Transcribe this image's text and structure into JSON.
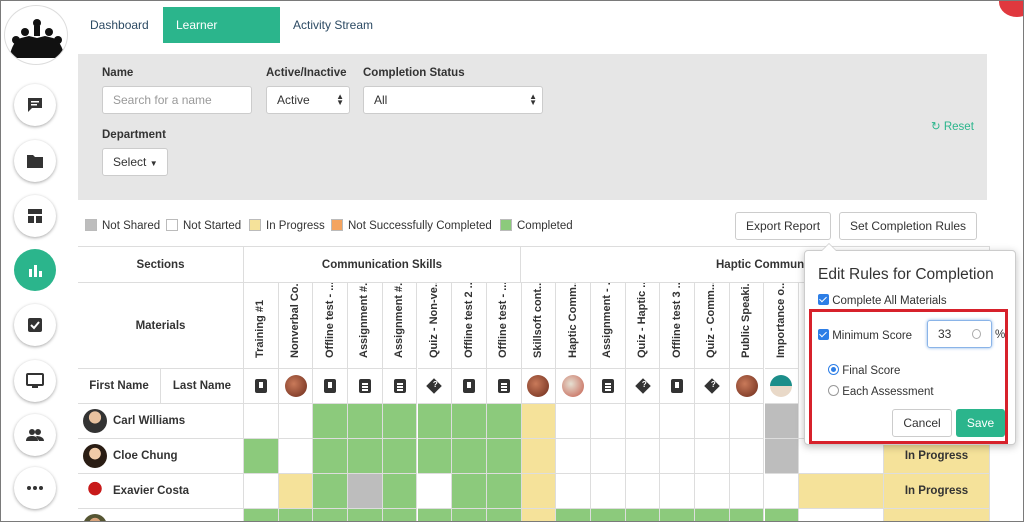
{
  "tabs": [
    "Dashboard",
    "Learner Progress",
    "Activity Stream"
  ],
  "filters": {
    "name_label": "Name",
    "name_placeholder": "Search for a name",
    "active_label": "Active/Inactive",
    "active_value": "Active",
    "completion_label": "Completion Status",
    "completion_value": "All",
    "department_label": "Department",
    "department_value": "Select",
    "reset": "Reset"
  },
  "legend": [
    {
      "label": "Not Shared",
      "color": "#bdbdbd"
    },
    {
      "label": "Not Started",
      "color": "#ffffff"
    },
    {
      "label": "In Progress",
      "color": "#f5e29a"
    },
    {
      "label": "Not Successfully Completed",
      "color": "#f4a460"
    },
    {
      "label": "Completed",
      "color": "#8cca7c"
    }
  ],
  "buttons": {
    "export": "Export Report",
    "rules": "Set Completion Rules"
  },
  "grid": {
    "sections_label": "Sections",
    "materials_label": "Materials",
    "first_name": "First Name",
    "last_name": "Last Name",
    "section_comm": "Communication Skills",
    "section_haptic": "Haptic Commun",
    "materials": [
      {
        "label": "Training #1",
        "icon": "download-icon"
      },
      {
        "label": "Nonverbal Co...",
        "icon": "thumb-red"
      },
      {
        "label": "Offline test - ...",
        "icon": "download-icon"
      },
      {
        "label": "Assignment #...",
        "icon": "assignment-icon"
      },
      {
        "label": "Assignment #...",
        "icon": "assignment-icon"
      },
      {
        "label": "Quiz - Non-ve...",
        "icon": "quiz-icon"
      },
      {
        "label": "Offline test 2 ...",
        "icon": "download-icon"
      },
      {
        "label": "Offline test - ...",
        "icon": "assignment-icon"
      },
      {
        "label": "Skillsoft cont...",
        "icon": "thumb-red"
      },
      {
        "label": "Haptic Comm...",
        "icon": "thumb-blue"
      },
      {
        "label": "Assignment - ...",
        "icon": "assignment-icon"
      },
      {
        "label": "Quiz - Haptic ...",
        "icon": "quiz-icon"
      },
      {
        "label": "Offline test 3 ...",
        "icon": "download-icon"
      },
      {
        "label": "Quiz - Comm...",
        "icon": "quiz-icon"
      },
      {
        "label": "Public Speaki...",
        "icon": "thumb-red"
      },
      {
        "label": "Importance o...",
        "icon": "thumb-teal"
      }
    ],
    "learners": [
      {
        "name": "Carl Williams",
        "status": "",
        "cells": [
          "w",
          "w",
          "g",
          "g",
          "g",
          "g",
          "g",
          "g",
          "y",
          "w",
          "w",
          "w",
          "w",
          "w",
          "w",
          "s"
        ]
      },
      {
        "name": "Cloe Chung",
        "status": "In Progress",
        "cells": [
          "g",
          "w",
          "g",
          "g",
          "g",
          "g",
          "g",
          "g",
          "y",
          "w",
          "w",
          "w",
          "w",
          "w",
          "w",
          "s"
        ]
      },
      {
        "name": "Exavier Costa",
        "status": "In Progress",
        "cells": [
          "w",
          "y",
          "g",
          "s",
          "g",
          "w",
          "g",
          "g",
          "y",
          "w",
          "w",
          "w",
          "w",
          "w",
          "w",
          "w"
        ]
      },
      {
        "name": "",
        "status": "",
        "cells": [
          "g",
          "g",
          "g",
          "g",
          "g",
          "g",
          "g",
          "g",
          "y",
          "g",
          "g",
          "g",
          "g",
          "g",
          "g",
          "g"
        ]
      }
    ]
  },
  "popup": {
    "title": "Edit Rules for Completion",
    "complete_all": "Complete All Materials",
    "min_score": "Minimum Score",
    "min_value": "33",
    "percent": "%",
    "final_score": "Final Score",
    "each_assessment": "Each Assessment",
    "cancel": "Cancel",
    "save": "Save"
  }
}
